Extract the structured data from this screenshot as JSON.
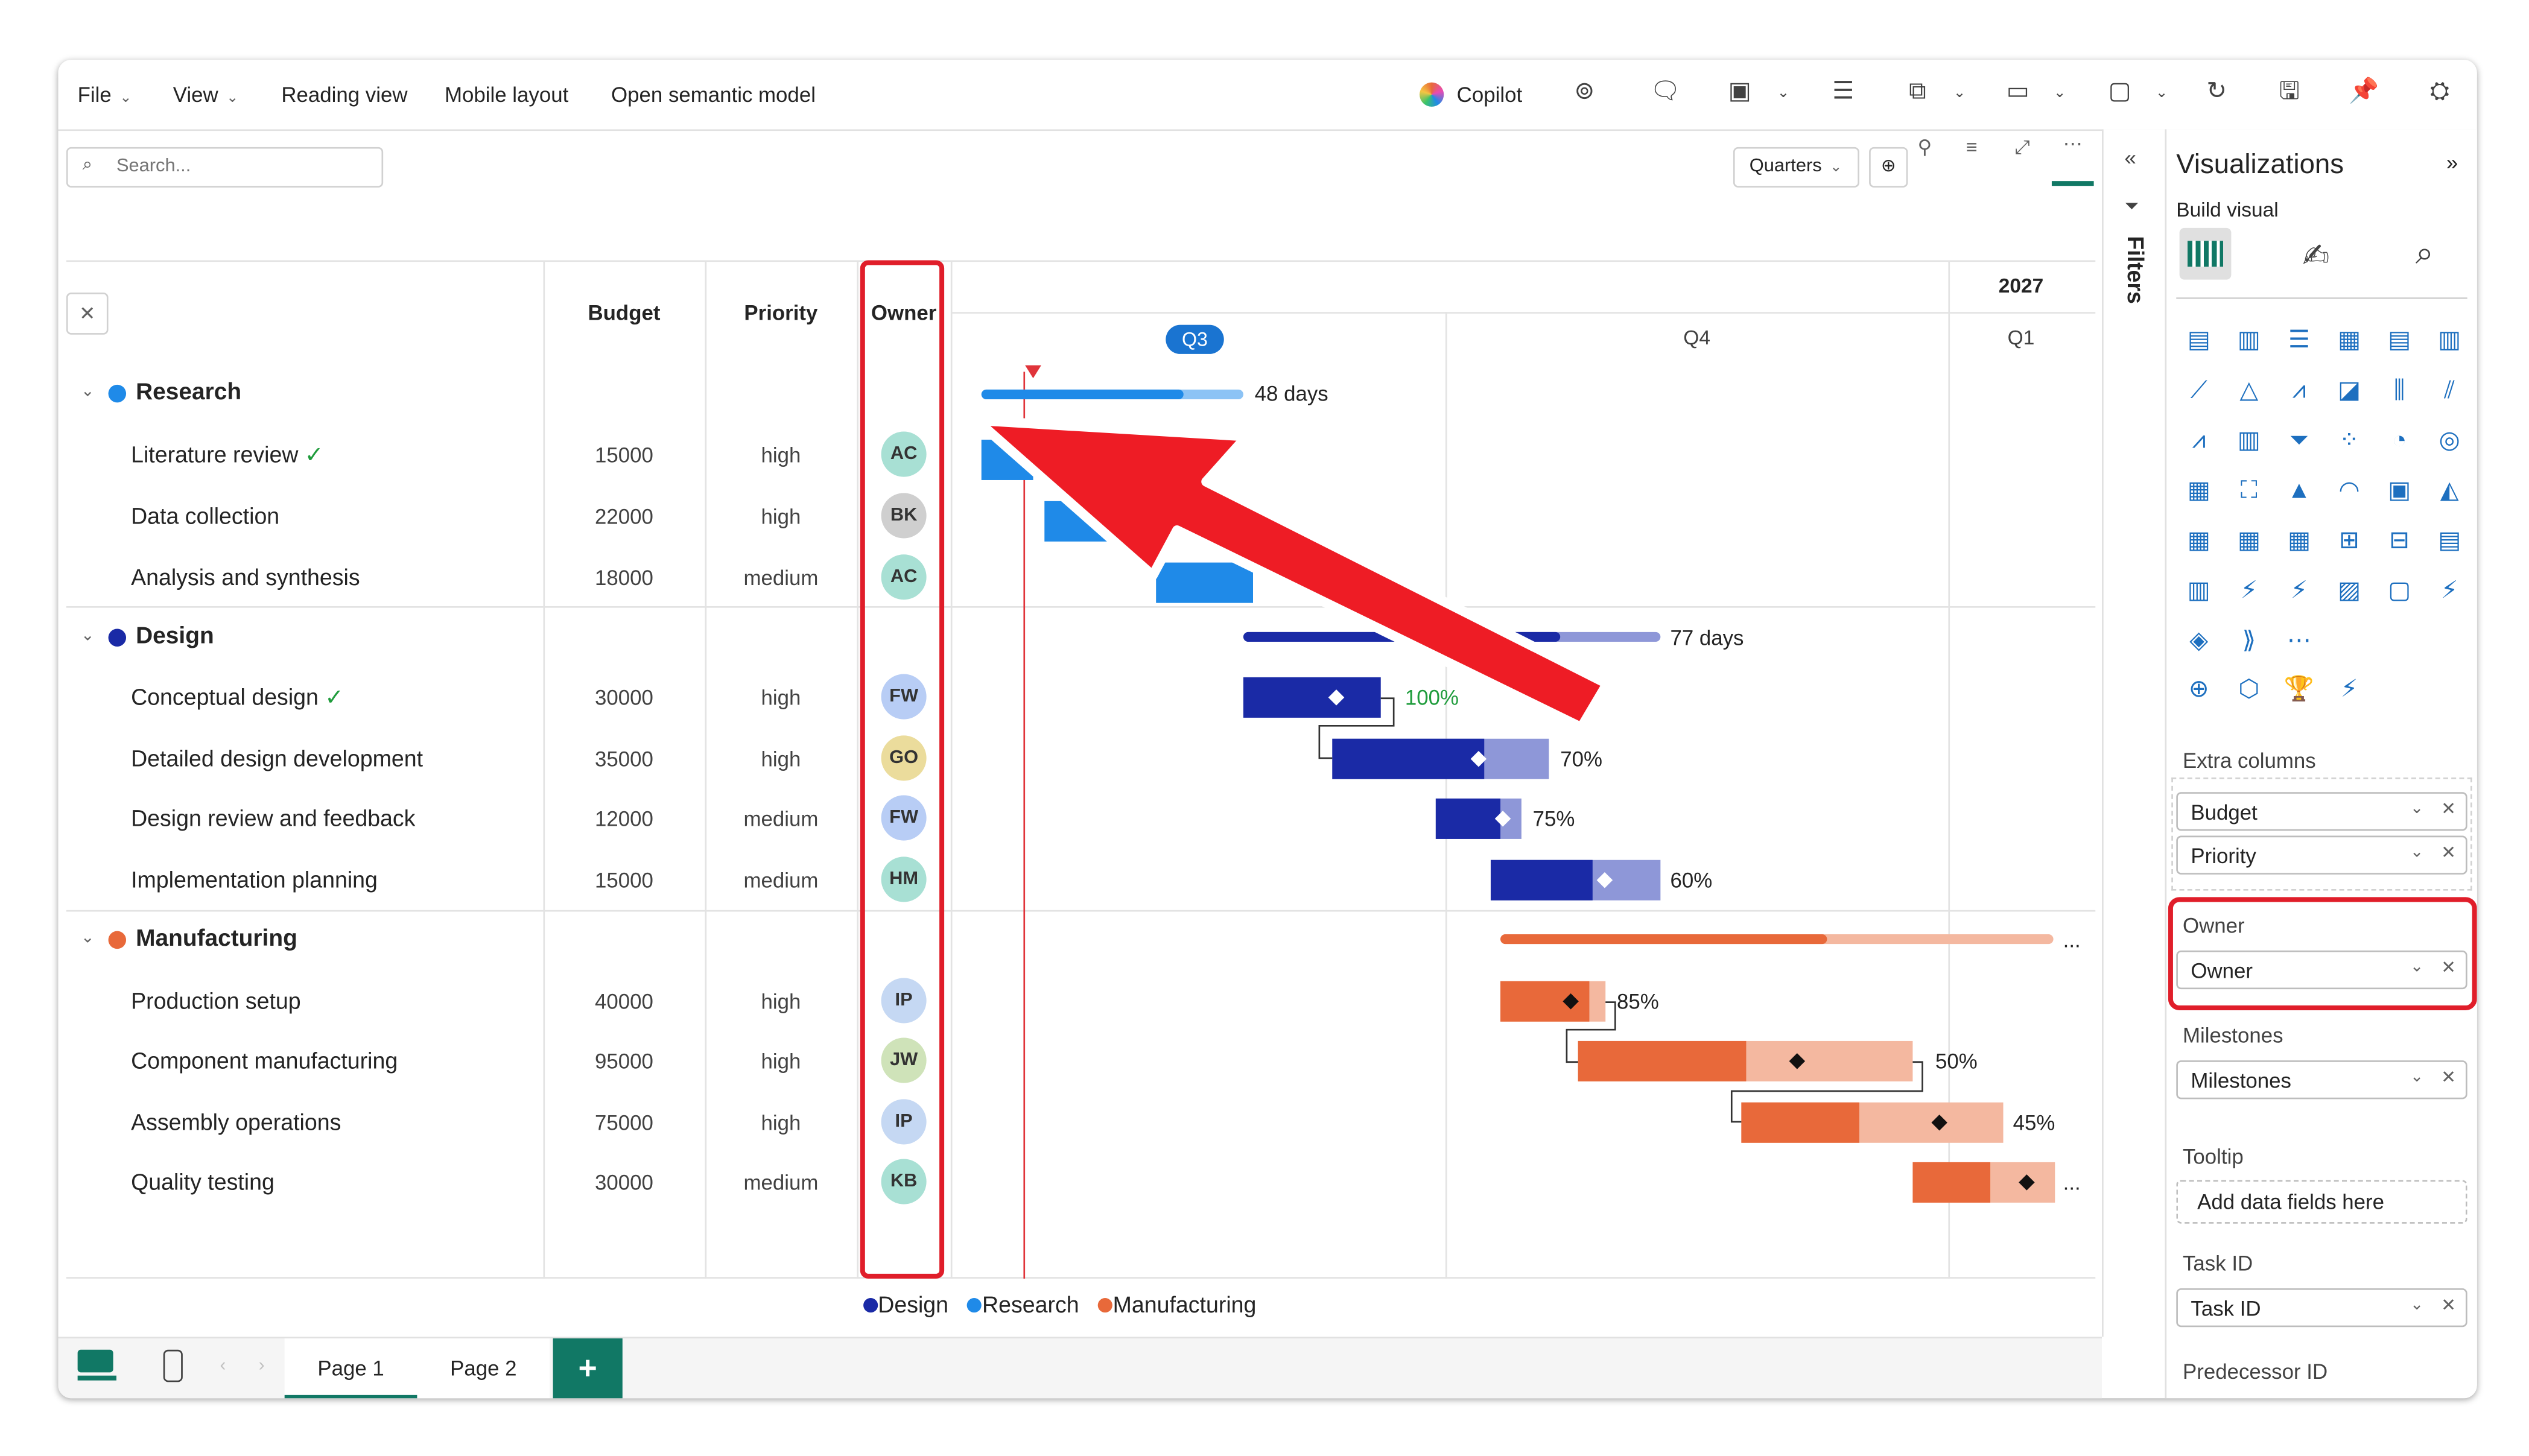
{
  "menu": {
    "file": "File",
    "view": "View",
    "reading": "Reading view",
    "mobile": "Mobile layout",
    "semantic": "Open semantic model",
    "copilot": "Copilot"
  },
  "search": {
    "placeholder": "Search..."
  },
  "view_select": "Quarters",
  "columns": {
    "budget": "Budget",
    "priority": "Priority",
    "owner": "Owner"
  },
  "timeline": {
    "year": "2027",
    "q3": "Q3",
    "q4": "Q4",
    "q1": "Q1"
  },
  "groups": [
    {
      "name": "Research",
      "color": "#1f8ae8",
      "summary": "48 days",
      "tasks": [
        {
          "name": "Literature review",
          "done": "✓",
          "budget": "15000",
          "priority": "high",
          "owner": "AC"
        },
        {
          "name": "Data collection",
          "budget": "22000",
          "priority": "high",
          "owner": "BK"
        },
        {
          "name": "Analysis and synthesis",
          "budget": "18000",
          "priority": "medium",
          "owner": "AC"
        }
      ]
    },
    {
      "name": "Design",
      "color": "#1a2aa6",
      "summary": "77 days",
      "tasks": [
        {
          "name": "Conceptual design",
          "done": "✓",
          "budget": "30000",
          "priority": "high",
          "owner": "FW",
          "pct": "100%"
        },
        {
          "name": "Detailed design development",
          "budget": "35000",
          "priority": "high",
          "owner": "GO",
          "pct": "70%"
        },
        {
          "name": "Design review and feedback",
          "budget": "12000",
          "priority": "medium",
          "owner": "FW",
          "pct": "75%"
        },
        {
          "name": "Implementation planning",
          "budget": "15000",
          "priority": "medium",
          "owner": "HM",
          "pct": "60%"
        }
      ]
    },
    {
      "name": "Manufacturing",
      "color": "#e8693a",
      "summary": "...",
      "tasks": [
        {
          "name": "Production setup",
          "budget": "40000",
          "priority": "high",
          "owner": "IP",
          "pct": "85%"
        },
        {
          "name": "Component manufacturing",
          "budget": "95000",
          "priority": "high",
          "owner": "JW",
          "pct": "50%"
        },
        {
          "name": "Assembly operations",
          "budget": "75000",
          "priority": "high",
          "owner": "IP",
          "pct": "45%"
        },
        {
          "name": "Quality testing",
          "budget": "30000",
          "priority": "medium",
          "owner": "KB",
          "pct": "..."
        }
      ]
    }
  ],
  "legend": [
    "Design",
    "Research",
    "Manufacturing"
  ],
  "viz": {
    "title": "Visualizations",
    "build": "Build visual",
    "extra_columns": "Extra columns",
    "f_budget": "Budget",
    "f_priority": "Priority",
    "owner_label": "Owner",
    "f_owner": "Owner",
    "milestones_label": "Milestones",
    "f_milestones": "Milestones",
    "tooltip_label": "Tooltip",
    "tooltip_placeholder": "Add data fields here",
    "taskid_label": "Task ID",
    "f_taskid": "Task ID",
    "pred_label": "Predecessor ID",
    "filters": "Filters"
  },
  "pages": {
    "p1": "Page 1",
    "p2": "Page 2",
    "add": "+"
  }
}
